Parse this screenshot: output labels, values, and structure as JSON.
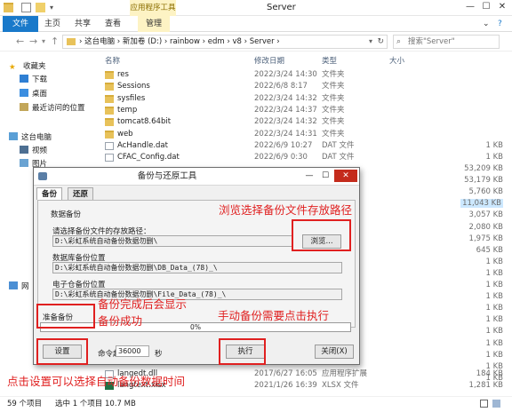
{
  "window": {
    "title": "Server",
    "context_tab_group": "应用程序工具",
    "controls": {
      "minimize": "—",
      "maximize": "☐",
      "close": "✕"
    }
  },
  "ribbon": {
    "tabs": [
      "文件",
      "主页",
      "共享",
      "查看",
      "管理"
    ]
  },
  "address": {
    "path": "›  这台电脑  ›  新加卷 (D:)  ›  rainbow  ›  edm  ›  v8  ›  Server  ›",
    "search_placeholder": "搜索\"Server\""
  },
  "nav": {
    "items": [
      "收藏夹",
      "下载",
      "桌面",
      "最近访问的位置",
      "这台电脑",
      "视频",
      "图片",
      "网"
    ]
  },
  "columns": {
    "name": "名称",
    "date": "修改日期",
    "type": "类型",
    "size": "大小"
  },
  "files": [
    {
      "name": "res",
      "date": "2022/3/24 14:30",
      "type": "文件夹",
      "size": "",
      "kind": "folder"
    },
    {
      "name": "Sessions",
      "date": "2022/6/8 8:17",
      "type": "文件夹",
      "size": "",
      "kind": "folder"
    },
    {
      "name": "sysfiles",
      "date": "2022/3/24 14:32",
      "type": "文件夹",
      "size": "",
      "kind": "folder"
    },
    {
      "name": "temp",
      "date": "2022/3/24 14:37",
      "type": "文件夹",
      "size": "",
      "kind": "folder"
    },
    {
      "name": "tomcat8.64bit",
      "date": "2022/3/24 14:32",
      "type": "文件夹",
      "size": "",
      "kind": "folder"
    },
    {
      "name": "web",
      "date": "2022/3/24 14:31",
      "type": "文件夹",
      "size": "",
      "kind": "folder"
    },
    {
      "name": "AcHandle.dat",
      "date": "2022/6/9 10:27",
      "type": "DAT 文件",
      "size": "1 KB",
      "kind": "file"
    },
    {
      "name": "CFAC_Config.dat",
      "date": "2022/6/9 0:30",
      "type": "DAT 文件",
      "size": "1 KB",
      "kind": "file"
    }
  ],
  "right_sizes": [
    "53,209 KB",
    "53,179 KB",
    "5,760 KB",
    "11,043 KB",
    "3,057 KB",
    "2,080 KB",
    "1,975 KB",
    "645 KB",
    "1 KB",
    "1 KB",
    "1 KB",
    "1 KB",
    "1 KB",
    "1 KB",
    "1 KB",
    "1 KB",
    "1 KB",
    "1 KB",
    "1 KB"
  ],
  "hidden_partial_size": "5,760 KB",
  "bottom_files": [
    {
      "name": "langedt.dll",
      "date": "2017/6/27 16:05",
      "type": "应用程序扩展",
      "size": "184 KB"
    },
    {
      "name": "langtext.xlsx",
      "date": "2021/1/26 16:39",
      "type": "XLSX 文件",
      "size": "1,281 KB"
    }
  ],
  "status": {
    "count": "59 个项目",
    "selected": "选中 1 个项目  10.7 MB"
  },
  "dialog": {
    "title": "备份与还原工具",
    "tabs": [
      "备份",
      "还原"
    ],
    "section_title": "数据备份",
    "path_label": "请选择备份文件的存放路径：",
    "path_value": "D:\\彩虹系统自动备份数据勿删\\",
    "browse_label": "浏览...",
    "db_label": "数据库备份位置",
    "db_value": "D:\\彩虹系统自动备份数据勿删\\DB_Data_(78)_\\",
    "file_label": "电子仓备份位置",
    "file_value": "D:\\彩虹系统自动备份数据勿删\\File_Data_(78)_\\",
    "status_text": "准备备份",
    "progress_text": "0%",
    "progress": 0,
    "settings_label": "设置",
    "timeout_label": "命令超时",
    "timeout_value": "36000",
    "timeout_unit": "秒",
    "execute_label": "执行",
    "close_label": "关闭(X)"
  },
  "annotations": {
    "browse": "浏览选择备份文件存放路径",
    "done1": "备份完成后会显示",
    "done2": "备份成功",
    "manual": "手动备份需要点击执行",
    "settings": "点击设置可以选择自动备份数据时间"
  },
  "colors": {
    "accent": "#1979ca",
    "annotation": "#e02020",
    "folder": "#e8c25a",
    "close": "#c42b1c"
  }
}
